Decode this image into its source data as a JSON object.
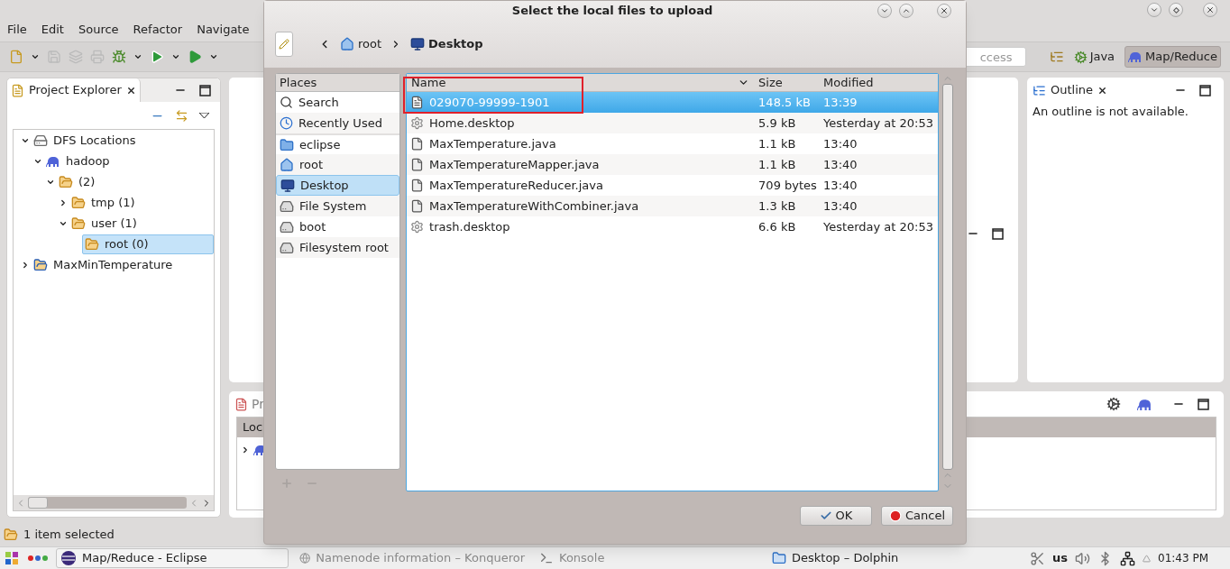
{
  "eclipse": {
    "menu": [
      "File",
      "Edit",
      "Source",
      "Refactor",
      "Navigate"
    ],
    "quick_access": {
      "placeholder": "ccess"
    },
    "perspectives": [
      {
        "label": "Java",
        "selected": false
      },
      {
        "label": "Map/Reduce",
        "selected": true
      }
    ],
    "project_explorer": {
      "title": "Project Explorer",
      "tree": [
        {
          "label": "DFS Locations",
          "kind": "server",
          "expanded": true,
          "selected": false,
          "children": [
            {
              "label": "hadoop",
              "kind": "elephant",
              "expanded": true,
              "selected": false,
              "children": [
                {
                  "label": "(2)",
                  "kind": "folder",
                  "expanded": true,
                  "selected": false,
                  "children": [
                    {
                      "label": "tmp (1)",
                      "kind": "folder",
                      "expanded": false,
                      "selected": false
                    },
                    {
                      "label": "user (1)",
                      "kind": "folder",
                      "expanded": true,
                      "selected": false,
                      "children": [
                        {
                          "label": "root (0)",
                          "kind": "folder",
                          "selected": true
                        }
                      ]
                    }
                  ]
                }
              ]
            }
          ]
        },
        {
          "label": "MaxMinTemperature",
          "kind": "project",
          "expanded": false,
          "selected": false
        }
      ]
    },
    "outline": {
      "title": "Outline",
      "message": "An outline is not available."
    },
    "bottom_panel": {
      "title": "Pr",
      "column": "Loc"
    },
    "status": "1 item selected"
  },
  "dialog": {
    "title": "Select the local files to upload",
    "breadcrumb": [
      {
        "label": "root",
        "kind": "home"
      },
      {
        "label": "Desktop",
        "kind": "desktop"
      }
    ],
    "places_header": "Places",
    "places": [
      {
        "label": "Search",
        "kind": "search",
        "selected": false
      },
      {
        "label": "Recently Used",
        "kind": "recent",
        "selected": false
      },
      {
        "label": "eclipse",
        "kind": "folder",
        "selected": false
      },
      {
        "label": "root",
        "kind": "home",
        "selected": false
      },
      {
        "label": "Desktop",
        "kind": "desktop",
        "selected": true
      },
      {
        "label": "File System",
        "kind": "drive",
        "selected": false
      },
      {
        "label": "boot",
        "kind": "drive",
        "selected": false
      },
      {
        "label": "Filesystem root",
        "kind": "drive",
        "selected": false
      }
    ],
    "columns": [
      "Name",
      "Size",
      "Modified"
    ],
    "files": [
      {
        "name": "029070-99999-1901",
        "size": "148.5 kB",
        "modified": "13:39",
        "kind": "text",
        "selected": true
      },
      {
        "name": "Home.desktop",
        "size": "5.9 kB",
        "modified": "Yesterday at 20:53",
        "kind": "desktop",
        "selected": false
      },
      {
        "name": "MaxTemperature.java",
        "size": "1.1 kB",
        "modified": "13:40",
        "kind": "java",
        "selected": false
      },
      {
        "name": "MaxTemperatureMapper.java",
        "size": "1.1 kB",
        "modified": "13:40",
        "kind": "java",
        "selected": false
      },
      {
        "name": "MaxTemperatureReducer.java",
        "size": "709 bytes",
        "modified": "13:40",
        "kind": "java",
        "selected": false
      },
      {
        "name": "MaxTemperatureWithCombiner.java",
        "size": "1.3 kB",
        "modified": "13:40",
        "kind": "java",
        "selected": false
      },
      {
        "name": "trash.desktop",
        "size": "6.6 kB",
        "modified": "Yesterday at 20:53",
        "kind": "desktop",
        "selected": false
      }
    ],
    "buttons": [
      {
        "label": "OK",
        "kind": "ok"
      },
      {
        "label": "Cancel",
        "kind": "cancel"
      }
    ]
  },
  "taskbar": {
    "tasks": [
      {
        "label": "Map/Reduce - Eclipse",
        "kind": "eclipse",
        "active": true
      },
      {
        "label": "Namenode information – Konqueror",
        "kind": "browser",
        "active": false
      },
      {
        "label": "Konsole",
        "kind": "terminal",
        "active": false
      },
      {
        "label": "Desktop – Dolphin",
        "kind": "filemanager",
        "active": true
      }
    ],
    "keyboard": "us",
    "clock": "01:43 PM"
  }
}
